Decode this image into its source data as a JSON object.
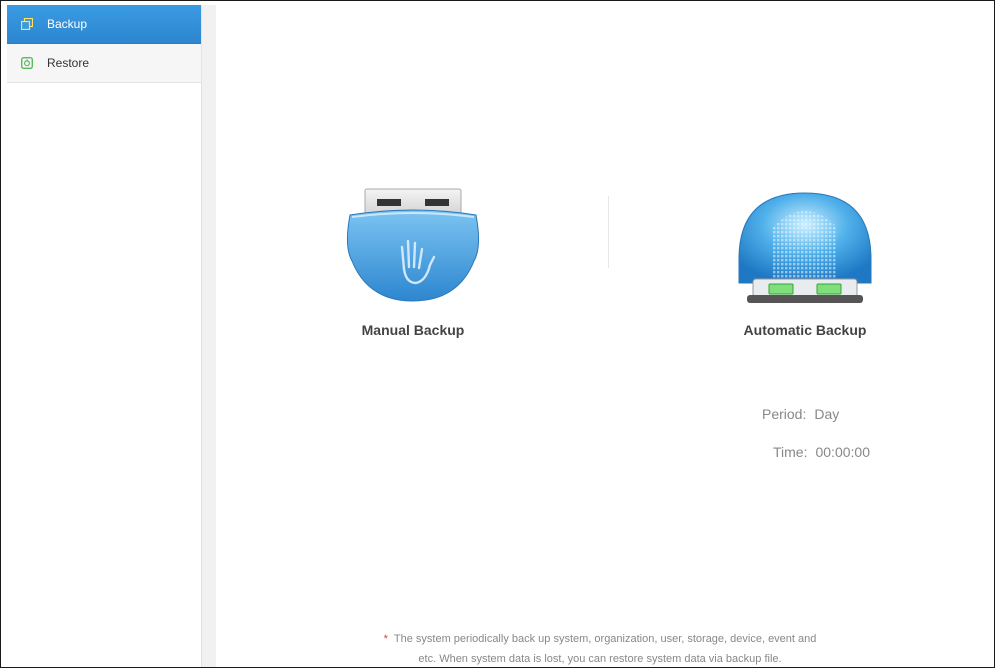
{
  "sidebar": {
    "items": [
      {
        "label": "Backup",
        "icon": "backup-icon",
        "active": true
      },
      {
        "label": "Restore",
        "icon": "restore-icon",
        "active": false
      }
    ]
  },
  "main": {
    "manual": {
      "label": "Manual Backup",
      "icon": "manual-backup-icon"
    },
    "automatic": {
      "label": "Automatic Backup",
      "icon": "automatic-backup-icon"
    },
    "period": {
      "label": "Period:",
      "value": "Day"
    },
    "time": {
      "label": "Time:",
      "value": "00:00:00"
    },
    "note": {
      "line1": "The system periodically back up system, organization, user, storage, device, event and",
      "line2": "etc. When system data is lost, you can restore system data via backup file."
    }
  },
  "colors": {
    "accent": "#2d86cf",
    "restore_icon": "#5cb85c",
    "star": "#e23a3a"
  }
}
